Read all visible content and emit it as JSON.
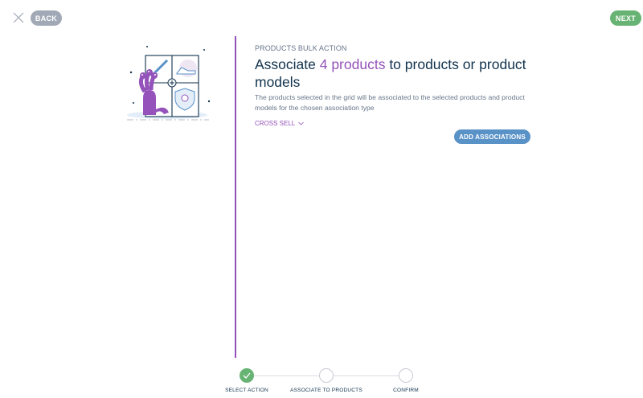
{
  "header": {
    "back_label": "BACK",
    "next_label": "NEXT"
  },
  "content": {
    "kicker": "PRODUCTS BULK ACTION",
    "title_prefix": "Associate ",
    "title_accent": "4 products",
    "title_suffix": " to products or product models",
    "description": "The products selected in the grid will be associated to the selected products and product models for the chosen association type",
    "association_type": "CROSS SELL",
    "add_button_label": "ADD ASSOCIATIONS"
  },
  "steps": [
    {
      "label": "SELECT ACTION",
      "state": "done"
    },
    {
      "label": "ASSOCIATE TO PRODUCTS",
      "state": "todo"
    },
    {
      "label": "CONFIRM",
      "state": "todo"
    }
  ],
  "colors": {
    "accent": "#9452ba",
    "primary": "#5992c7",
    "success": "#67b373",
    "muted": "#a1a9b7"
  }
}
